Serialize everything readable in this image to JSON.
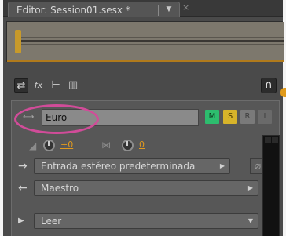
{
  "editor_tab": {
    "title": "Editor: Session01.sesx *",
    "menu_icon": "chevron-down-icon",
    "close_icon": "close-icon"
  },
  "toolbar": {
    "tools": [
      {
        "name": "inputs-outputs-icon",
        "glyph": "⇄",
        "active": true
      },
      {
        "name": "effects-icon",
        "glyph": "fx",
        "active": false
      },
      {
        "name": "sends-icon",
        "glyph": "P",
        "active": false
      },
      {
        "name": "eq-icon",
        "glyph": "▥",
        "active": false
      }
    ],
    "snap_icon": "magnet-icon",
    "snap_glyph": "∩"
  },
  "track": {
    "name_value": "Euro",
    "buttons": {
      "mute": "M",
      "solo": "S",
      "record": "R",
      "input": "I"
    },
    "volume_value": "+0",
    "pan_value": "0",
    "input_select": "Entrada estéreo predeterminada",
    "output_select": "Maestro",
    "read_select": "Leer",
    "fx_bypass_glyph": "⌀"
  },
  "colors": {
    "mute_active": "#2dbd6e",
    "solo_active": "#d8b42a",
    "value_text": "#e19a1e",
    "highlight_ring": "#d14c99"
  }
}
